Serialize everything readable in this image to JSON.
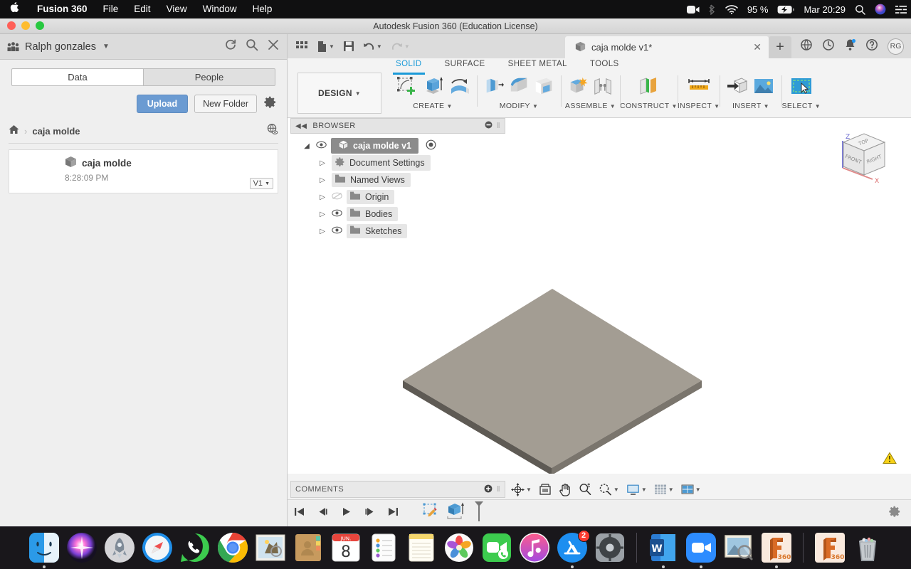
{
  "macos_menubar": {
    "apple_icon": "apple-logo-icon",
    "app_name": "Fusion 360",
    "menus": [
      "File",
      "Edit",
      "View",
      "Window",
      "Help"
    ],
    "status": {
      "screen_recording_icon": "video-camera-icon",
      "bluetooth_icon": "bluetooth-icon",
      "wifi_icon": "wifi-icon",
      "battery_percent": "95 %",
      "battery_icon": "battery-charging-icon",
      "datetime": "Mar 20:29",
      "search_icon": "spotlight-search-icon",
      "siri_icon": "siri-icon",
      "controlcenter_icon": "control-center-icon"
    }
  },
  "window": {
    "title": "Autodesk Fusion 360 (Education License)",
    "traffic_lights": [
      "close",
      "minimize",
      "zoom"
    ]
  },
  "data_panel": {
    "team_name": "Ralph gonzales",
    "team_icon": "people-group-icon",
    "header_actions": [
      "refresh-icon",
      "search-icon",
      "close-icon"
    ],
    "tabs": [
      {
        "label": "Data",
        "active": true
      },
      {
        "label": "People",
        "active": false
      }
    ],
    "upload_label": "Upload",
    "new_folder_label": "New Folder",
    "settings_icon": "gear-icon",
    "breadcrumb": {
      "home_icon": "home-icon",
      "separator": "›",
      "current": "caja molde",
      "globe_icon": "globe-visibility-icon"
    },
    "file": {
      "name": "caja molde",
      "thumb_icon": "3d-box-icon",
      "time": "8:28:09 PM",
      "version": "V1"
    }
  },
  "quick_access": {
    "grid_icon": "app-grid-icon",
    "new_icon": "new-document-icon",
    "save_icon": "save-icon",
    "undo_icon": "undo-icon",
    "redo_icon": "redo-icon"
  },
  "document_tab": {
    "icon": "3d-box-icon",
    "label": "caja molde v1*",
    "close_icon": "close-icon",
    "new_tab_icon": "plus-icon"
  },
  "header_icons": {
    "extensions_icon": "globe-clock-icon",
    "job_status_icon": "clock-icon",
    "notifications_icon": "bell-icon",
    "help_icon": "question-mark-icon",
    "avatar_initials": "RG"
  },
  "ribbon": {
    "tabs": [
      {
        "label": "SOLID",
        "active": true
      },
      {
        "label": "SURFACE",
        "active": false
      },
      {
        "label": "SHEET METAL",
        "active": false
      },
      {
        "label": "TOOLS",
        "active": false
      }
    ],
    "workspace_label": "DESIGN",
    "panels": [
      {
        "label": "CREATE",
        "tools": [
          "create-sketch-icon",
          "extrude-icon",
          "revolve-icon"
        ]
      },
      {
        "label": "MODIFY",
        "tools": [
          "press-pull-icon",
          "fillet-icon",
          "shell-icon"
        ]
      },
      {
        "label": "ASSEMBLE",
        "tools": [
          "new-component-icon",
          "joint-icon"
        ]
      },
      {
        "label": "CONSTRUCT",
        "tools": [
          "offset-plane-icon"
        ]
      },
      {
        "label": "INSPECT",
        "tools": [
          "measure-icon"
        ]
      },
      {
        "label": "INSERT",
        "tools": [
          "insert-derive-icon",
          "insert-canvas-icon"
        ]
      },
      {
        "label": "SELECT",
        "tools": [
          "select-window-icon"
        ]
      }
    ]
  },
  "browser": {
    "title": "BROWSER",
    "collapse_icon": "collapse-left-icon",
    "minimize_icon": "minus-circle-icon",
    "nodes": [
      {
        "label": "caja molde v1",
        "icon": "3d-box-icon",
        "eye": true,
        "root": true,
        "indent": 0,
        "twisty": "◢"
      },
      {
        "label": "Document Settings",
        "icon": "gear-icon",
        "eye": false,
        "indent": 1,
        "twisty": "▷"
      },
      {
        "label": "Named Views",
        "icon": "folder-icon",
        "eye": false,
        "indent": 1,
        "twisty": "▷"
      },
      {
        "label": "Origin",
        "icon": "folder-icon",
        "eye": true,
        "hidden_eye": true,
        "indent": 1,
        "twisty": "▷"
      },
      {
        "label": "Bodies",
        "icon": "folder-icon",
        "eye": true,
        "indent": 1,
        "twisty": "▷"
      },
      {
        "label": "Sketches",
        "icon": "folder-icon",
        "eye": true,
        "indent": 1,
        "twisty": "▷"
      }
    ]
  },
  "canvas": {
    "model_description": "flat rectangular gray slab body shown in isometric view",
    "model_top_color": "#a39d93",
    "model_side_color": "#6f6b64",
    "background_color": "#ffffff",
    "viewcube": {
      "faces": [
        "TOP",
        "FRONT",
        "RIGHT"
      ],
      "axis_z": "Z",
      "axis_x": "X"
    },
    "warning_icon": "warning-triangle-icon"
  },
  "comments": {
    "title": "COMMENTS",
    "add_icon": "add-comment-icon"
  },
  "nav_bar": {
    "tools": [
      "orbit-icon",
      "look-at-icon",
      "pan-icon",
      "zoom-icon",
      "zoom-window-icon",
      "display-settings-icon",
      "grid-snap-icon",
      "viewports-icon"
    ]
  },
  "timeline": {
    "controls": [
      "skip-to-start-icon",
      "step-back-icon",
      "play-icon",
      "step-forward-icon",
      "skip-to-end-icon"
    ],
    "features": [
      "sketch-feature-icon",
      "extrude-feature-icon"
    ],
    "settings_icon": "gear-icon"
  },
  "dock": {
    "items": [
      {
        "name": "finder",
        "running": true
      },
      {
        "name": "siri",
        "running": false
      },
      {
        "name": "launchpad",
        "running": false
      },
      {
        "name": "safari",
        "running": false
      },
      {
        "name": "whatsapp",
        "running": false
      },
      {
        "name": "chrome",
        "running": true
      },
      {
        "name": "mail",
        "running": false
      },
      {
        "name": "contacts",
        "running": false
      },
      {
        "name": "calendar",
        "running": false,
        "month": "JUN.",
        "day": "8"
      },
      {
        "name": "reminders",
        "running": false
      },
      {
        "name": "notes",
        "running": false
      },
      {
        "name": "photos",
        "running": false
      },
      {
        "name": "facetime",
        "running": false
      },
      {
        "name": "music",
        "running": false
      },
      {
        "name": "app-store",
        "running": true,
        "badge": "2"
      },
      {
        "name": "system-preferences",
        "running": false
      },
      {
        "name": "microsoft-word",
        "running": true
      },
      {
        "name": "zoom",
        "running": true
      },
      {
        "name": "preview",
        "running": false
      },
      {
        "name": "fusion-360",
        "running": true,
        "label": "360"
      },
      {
        "name": "fusion-360-alt",
        "running": false,
        "label": "360"
      },
      {
        "name": "trash",
        "running": false
      }
    ]
  }
}
